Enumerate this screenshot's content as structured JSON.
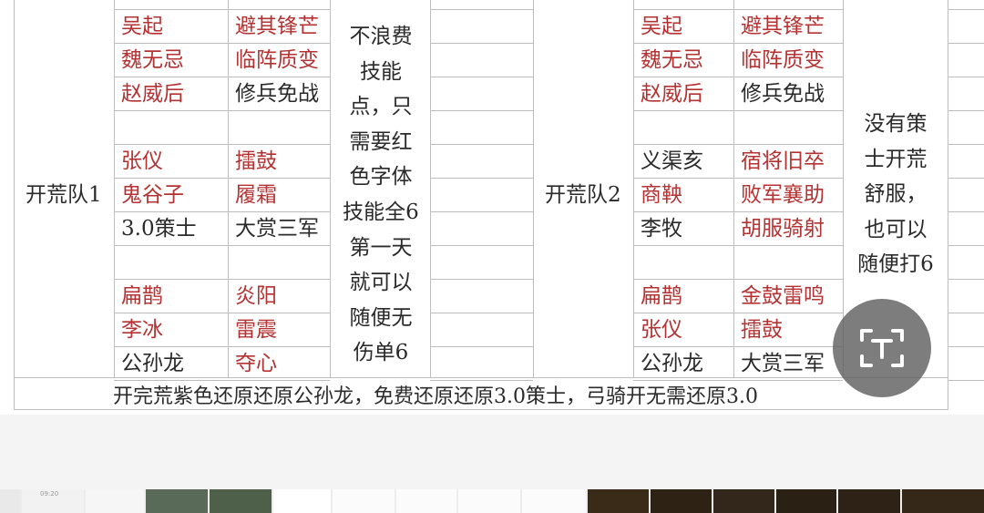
{
  "table": {
    "team1": {
      "name": "开荒队1",
      "rows": [
        [
          {
            "text": "吴起",
            "red": true
          },
          {
            "text": "避其锋芒",
            "red": true
          }
        ],
        [
          {
            "text": "魏无忌",
            "red": true
          },
          {
            "text": "临阵质变",
            "red": true
          }
        ],
        [
          {
            "text": "赵威后",
            "red": true
          },
          {
            "text": "修兵免战",
            "red": false
          }
        ],
        [
          {
            "text": "",
            "red": false
          },
          {
            "text": "",
            "red": false
          }
        ],
        [
          {
            "text": "张仪",
            "red": true
          },
          {
            "text": "擂鼓",
            "red": true
          }
        ],
        [
          {
            "text": "鬼谷子",
            "red": true
          },
          {
            "text": "履霜",
            "red": true
          }
        ],
        [
          {
            "text": "3.0策士",
            "red": false
          },
          {
            "text": "大赏三军",
            "red": false
          }
        ],
        [
          {
            "text": "",
            "red": false
          },
          {
            "text": "",
            "red": false
          }
        ],
        [
          {
            "text": "扁鹊",
            "red": true
          },
          {
            "text": "炎阳",
            "red": true
          }
        ],
        [
          {
            "text": "李冰",
            "red": true
          },
          {
            "text": "雷震",
            "red": true
          }
        ],
        [
          {
            "text": "公孙龙",
            "red": false
          },
          {
            "text": "夺心",
            "red": true
          }
        ]
      ],
      "note_lines": [
        "不浪费",
        "技能",
        "点，只",
        "需要红",
        "色字体",
        "技能全6",
        "第一天",
        "就可以",
        "随便无",
        "伤单6"
      ]
    },
    "team2": {
      "name": "开荒队2",
      "rows": [
        [
          {
            "text": "吴起",
            "red": true
          },
          {
            "text": "避其锋芒",
            "red": true
          }
        ],
        [
          {
            "text": "魏无忌",
            "red": true
          },
          {
            "text": "临阵质变",
            "red": true
          }
        ],
        [
          {
            "text": "赵威后",
            "red": true
          },
          {
            "text": "修兵免战",
            "red": false
          }
        ],
        [
          {
            "text": "",
            "red": false
          },
          {
            "text": "",
            "red": false
          }
        ],
        [
          {
            "text": "义渠亥",
            "red": false
          },
          {
            "text": "宿将旧卒",
            "red": true
          }
        ],
        [
          {
            "text": "商鞅",
            "red": true
          },
          {
            "text": "败军襄助",
            "red": true
          }
        ],
        [
          {
            "text": "李牧",
            "red": false
          },
          {
            "text": "胡服骑射",
            "red": true
          }
        ],
        [
          {
            "text": "",
            "red": false
          },
          {
            "text": "",
            "red": false
          }
        ],
        [
          {
            "text": "扁鹊",
            "red": true
          },
          {
            "text": "金鼓雷鸣",
            "red": true
          }
        ],
        [
          {
            "text": "张仪",
            "red": true
          },
          {
            "text": "擂鼓",
            "red": true
          }
        ],
        [
          {
            "text": "公孙龙",
            "red": false
          },
          {
            "text": "大赏三军",
            "red": false
          }
        ]
      ],
      "note_lines": [
        "没有策",
        "士开荒",
        "舒服，",
        "也可以",
        "随便打6"
      ]
    },
    "footer": "开完荒紫色还原还原公孙龙，免费还原还原3.0策士，弓骑开无需还原3.0"
  },
  "overlay": {
    "scan_button_icon": "text-scan-icon"
  },
  "thumbnail_strip": {
    "count": 16,
    "timestamp": "09:20"
  },
  "colors": {
    "red_text": "#b53232",
    "black_text": "#2a2a2a",
    "grid": "#bdbdbd"
  }
}
